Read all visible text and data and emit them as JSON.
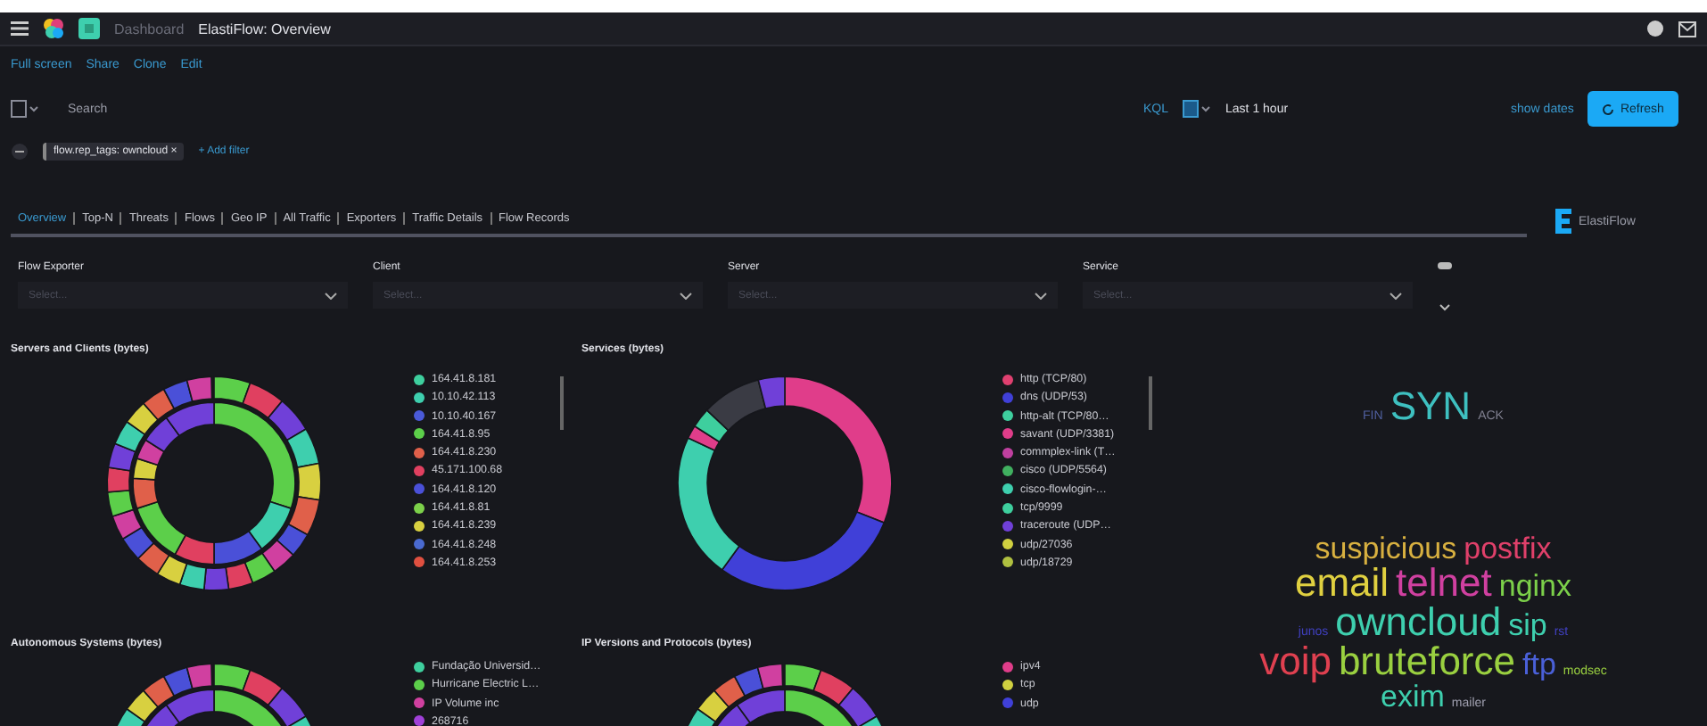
{
  "header": {
    "breadcrumb_parent": "Dashboard",
    "title": "ElastiFlow: Overview"
  },
  "top_links": [
    "Full screen",
    "Share",
    "Clone",
    "Edit"
  ],
  "query_bar": {
    "placeholder": "Search",
    "language": "KQL",
    "time_range": "Last 1 hour",
    "show_dates": "show dates",
    "refresh": "Refresh"
  },
  "filters": [
    {
      "label": "flow.rep_tags: owncloud",
      "remove": "×"
    }
  ],
  "add_filter": "+ Add filter",
  "nav_tabs": [
    {
      "label": "Overview",
      "selected": true
    },
    {
      "label": "Top-N",
      "selected": false
    },
    {
      "label": "Threats",
      "selected": false
    },
    {
      "label": "Flows",
      "selected": false
    },
    {
      "label": "Geo IP",
      "selected": false
    },
    {
      "label": "All Traffic",
      "selected": false
    },
    {
      "label": "Exporters",
      "selected": false
    },
    {
      "label": "Traffic Details",
      "selected": false
    },
    {
      "label": "Flow Records",
      "selected": false
    }
  ],
  "brand": "ElastiFlow",
  "controls": [
    {
      "label": "Flow Exporter",
      "placeholder": "Select..."
    },
    {
      "label": "Client",
      "placeholder": "Select..."
    },
    {
      "label": "Server",
      "placeholder": "Select..."
    },
    {
      "label": "Service",
      "placeholder": "Select..."
    }
  ],
  "panels": [
    {
      "title": "Servers and Clients (bytes)",
      "kind": "donut",
      "legend": [
        {
          "label": "164.41.8.181",
          "color": "#3ecf9e"
        },
        {
          "label": "10.10.42.113",
          "color": "#3ecfae"
        },
        {
          "label": "10.10.40.167",
          "color": "#4a5ad8"
        },
        {
          "label": "164.41.8.95",
          "color": "#5ccf4a"
        },
        {
          "label": "164.41.8.230",
          "color": "#e0604a"
        },
        {
          "label": "45.171.100.68",
          "color": "#e04060"
        },
        {
          "label": "164.41.8.120",
          "color": "#4a50d8"
        },
        {
          "label": "164.41.8.81",
          "color": "#7cd04a"
        },
        {
          "label": "164.41.8.239",
          "color": "#d8d040"
        },
        {
          "label": "164.41.8.248",
          "color": "#4a6ad0"
        },
        {
          "label": "164.41.8.253",
          "color": "#e05040"
        }
      ]
    },
    {
      "title": "Services (bytes)",
      "kind": "donut",
      "legend": [
        {
          "label": "http (TCP/80)",
          "color": "#e04070"
        },
        {
          "label": "dns (UDP/53)",
          "color": "#4040d8"
        },
        {
          "label": "http-alt (TCP/80…",
          "color": "#3ecf9e"
        },
        {
          "label": "savant (UDP/3381)",
          "color": "#e03d8a"
        },
        {
          "label": "commplex-link (T…",
          "color": "#c040a0"
        },
        {
          "label": "cisco (UDP/5564)",
          "color": "#40b060"
        },
        {
          "label": "cisco-flowlogin-…",
          "color": "#3ecfae"
        },
        {
          "label": "tcp/9999",
          "color": "#3ecf9e"
        },
        {
          "label": "traceroute (UDP…",
          "color": "#7040d8"
        },
        {
          "label": "udp/27036",
          "color": "#d0d040"
        },
        {
          "label": "udp/18729",
          "color": "#b0c040"
        }
      ]
    },
    {
      "kind": "wordcloud",
      "lines": [
        [
          {
            "text": "FIN",
            "color": "#5060a0",
            "kind": "s"
          },
          {
            "text": "SYN",
            "color": "#3ec0c0",
            "kind": "l"
          },
          {
            "text": "ACK",
            "color": "#808090",
            "kind": "s"
          }
        ],
        [
          {
            "text": "suspicious",
            "color": "#d8b040",
            "kind": "m"
          },
          {
            "text": "postfix",
            "color": "#e0406a",
            "kind": "m"
          }
        ],
        [
          {
            "text": "email",
            "color": "#e0d040",
            "kind": "l"
          },
          {
            "text": "telnet",
            "color": "#d040a0",
            "kind": "l"
          },
          {
            "text": "nginx",
            "color": "#7cd04a",
            "kind": "m"
          }
        ],
        [
          {
            "text": "junos",
            "color": "#4040c0",
            "kind": "s"
          },
          {
            "text": "owncloud",
            "color": "#3ecfae",
            "kind": "l"
          },
          {
            "text": "sip",
            "color": "#3ecfae",
            "kind": "m"
          },
          {
            "text": "rst",
            "color": "#4040c0",
            "kind": "s"
          }
        ],
        [
          {
            "text": "voip",
            "color": "#e04050",
            "kind": "l"
          },
          {
            "text": "bruteforce",
            "color": "#9ad040",
            "kind": "l"
          },
          {
            "text": "ftp",
            "color": "#4a60d8",
            "kind": "m"
          },
          {
            "text": "modsec",
            "color": "#9ad040",
            "kind": "s"
          }
        ],
        [
          {
            "text": "exim",
            "color": "#3ecfae",
            "kind": "m"
          },
          {
            "text": "mailer",
            "color": "#a0a0b0",
            "kind": "s"
          }
        ]
      ]
    },
    {
      "title": "Autonomous Systems (bytes)",
      "kind": "donut",
      "legend": [
        {
          "label": "Fundação Universid…",
          "color": "#3ecf9e"
        },
        {
          "label": "Hurricane Electric L…",
          "color": "#5ccf4a"
        },
        {
          "label": "IP Volume inc",
          "color": "#d040a0"
        },
        {
          "label": "268716",
          "color": "#a040d8"
        }
      ]
    },
    {
      "title": "IP Versions and Protocols (bytes)",
      "kind": "donut",
      "legend": [
        {
          "label": "ipv4",
          "color": "#e03d8a"
        },
        {
          "label": "tcp",
          "color": "#d0d040"
        },
        {
          "label": "udp",
          "color": "#4040d8"
        }
      ]
    }
  ]
}
